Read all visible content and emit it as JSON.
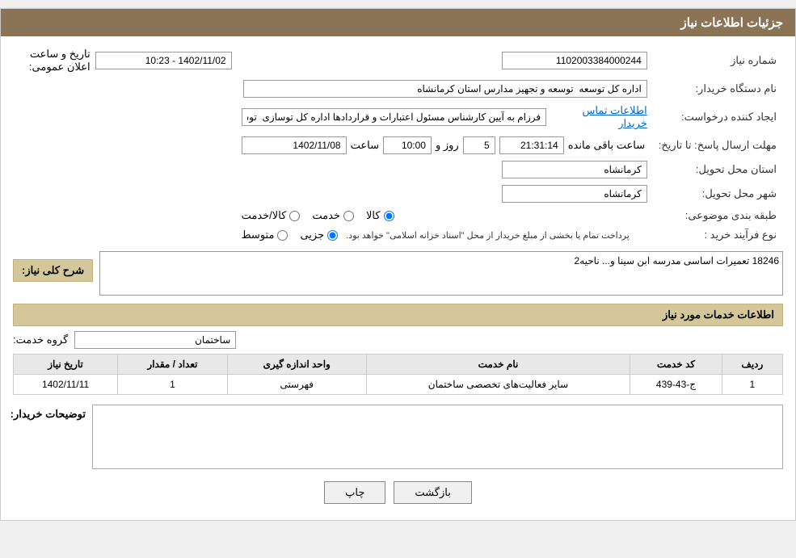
{
  "header": {
    "title": "جزئیات اطلاعات نیاز"
  },
  "section1": {
    "label": "شماره نیاز",
    "value": "1102003384000244"
  },
  "announcement": {
    "label": "تاریخ و ساعت اعلان عمومی:",
    "value": "1402/11/02 - 10:23"
  },
  "buyer_org": {
    "label": "نام دستگاه خریدار:",
    "value": "اداره کل توسعه  توسعه و تجهیز مدارس استان کرمانشاه"
  },
  "creator": {
    "label": "ایجاد کننده درخواست:",
    "value": "فرزام به آیین کارشناس مسئول اعتبارات و قراردادها اداره کل توسازی  توسعه و ت"
  },
  "contact_link": {
    "text": "اطلاعات تماس خریدار"
  },
  "deadline": {
    "label": "مهلت ارسال پاسخ: تا تاریخ:",
    "date_value": "1402/11/08",
    "time_label": "ساعت",
    "time_value": "10:00",
    "day_label": "روز و",
    "day_value": "5",
    "remaining_label": "ساعت باقی مانده",
    "remaining_value": "21:31:14"
  },
  "province_delivery": {
    "label": "استان محل تحویل:",
    "value": "کرمانشاه"
  },
  "city_delivery": {
    "label": "شهر محل تحویل:",
    "value": "کرمانشاه"
  },
  "category": {
    "label": "طبقه بندی موضوعی:",
    "options": [
      "کالا",
      "خدمت",
      "کالا/خدمت"
    ],
    "selected": "کالا"
  },
  "purchase_type": {
    "label": "نوع فرآیند خرید :",
    "options": [
      "جزیی",
      "متوسط"
    ],
    "note": "پرداخت تمام یا بخشی از مبلغ خریدار از محل \"اسناد خزانه اسلامی\" خواهد بود.",
    "selected": "جزیی"
  },
  "description_section": {
    "title": "شرح کلی نیاز:",
    "value": "18246 تعمیرات اساسی مدرسه ابن سینا و... ناحیه2"
  },
  "services_section": {
    "title": "اطلاعات خدمات مورد نیاز"
  },
  "service_group": {
    "label": "گروه خدمت:",
    "value": "ساختمان"
  },
  "table": {
    "headers": [
      "ردیف",
      "کد خدمت",
      "نام خدمت",
      "واحد اندازه گیری",
      "تعداد / مقدار",
      "تاریخ نیاز"
    ],
    "rows": [
      {
        "row": "1",
        "code": "ج-43-439",
        "name": "سایر فعالیت‌های تخصصی ساختمان",
        "unit": "فهرستی",
        "quantity": "1",
        "date": "1402/11/11"
      }
    ]
  },
  "buyer_note": {
    "label": "توضیحات خریدار:",
    "value": ""
  },
  "buttons": {
    "print": "چاپ",
    "back": "بازگشت"
  }
}
